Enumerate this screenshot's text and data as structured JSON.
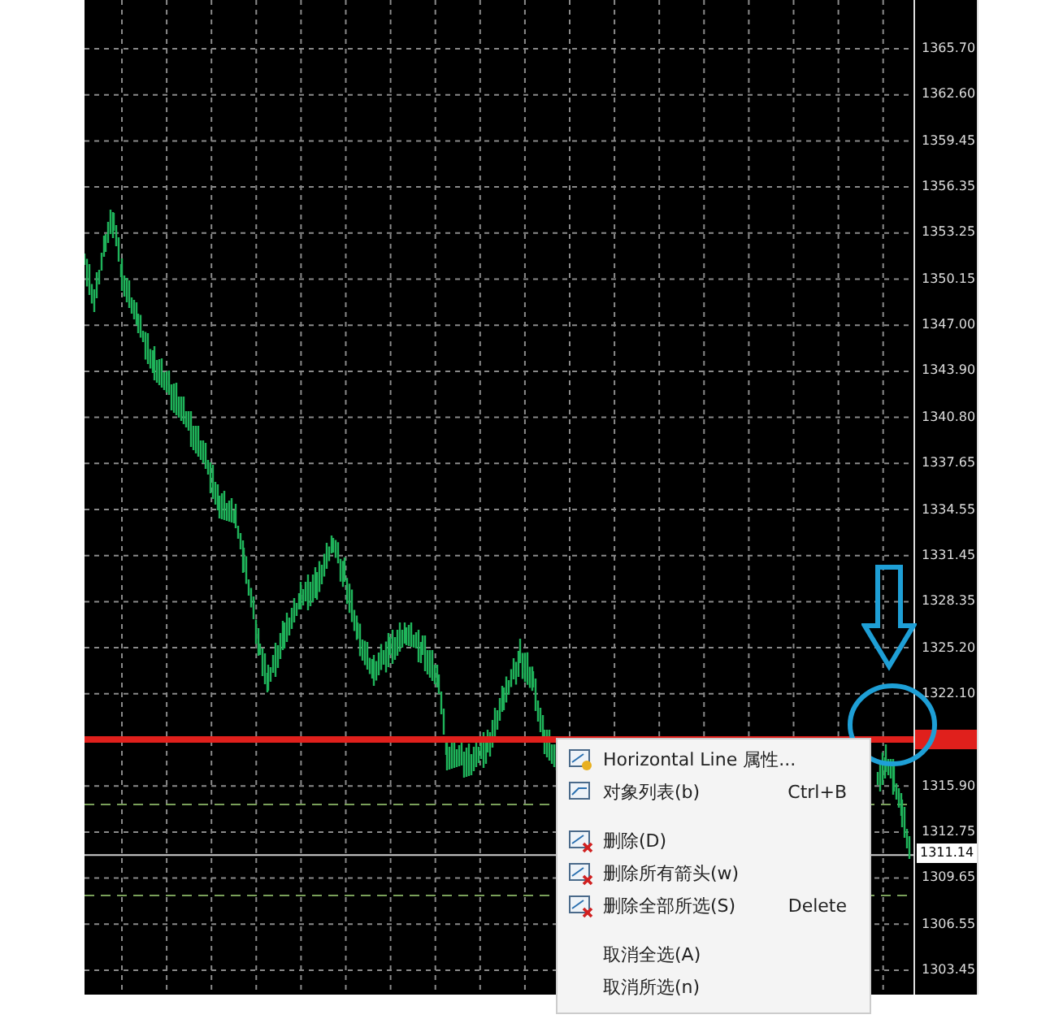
{
  "chart": {
    "price_scale": [
      "1365.70",
      "1362.60",
      "1359.45",
      "1356.35",
      "1353.25",
      "1350.15",
      "1347.00",
      "1343.90",
      "1340.80",
      "1337.65",
      "1334.55",
      "1331.45",
      "1328.35",
      "1325.20",
      "1322.10",
      "1315.90",
      "1312.75",
      "1309.65",
      "1306.55",
      "1303.45"
    ],
    "current_price": "1311.14"
  },
  "context_menu": {
    "items": [
      {
        "kind": "icon_item",
        "label": "Horizontal Line 属性..."
      },
      {
        "kind": "icon_item",
        "label": "对象列表(b)",
        "shortcut": "Ctrl+B"
      },
      {
        "kind": "separator"
      },
      {
        "kind": "icon_item",
        "label": "删除(D)"
      },
      {
        "kind": "icon_item",
        "label": "删除所有箭头(w)"
      },
      {
        "kind": "icon_item",
        "label": "删除全部所选(S)",
        "shortcut": "Delete"
      },
      {
        "kind": "separator"
      },
      {
        "kind": "item",
        "label": "取消全选(A)"
      },
      {
        "kind": "item",
        "label": "取消所选(n)"
      }
    ]
  }
}
